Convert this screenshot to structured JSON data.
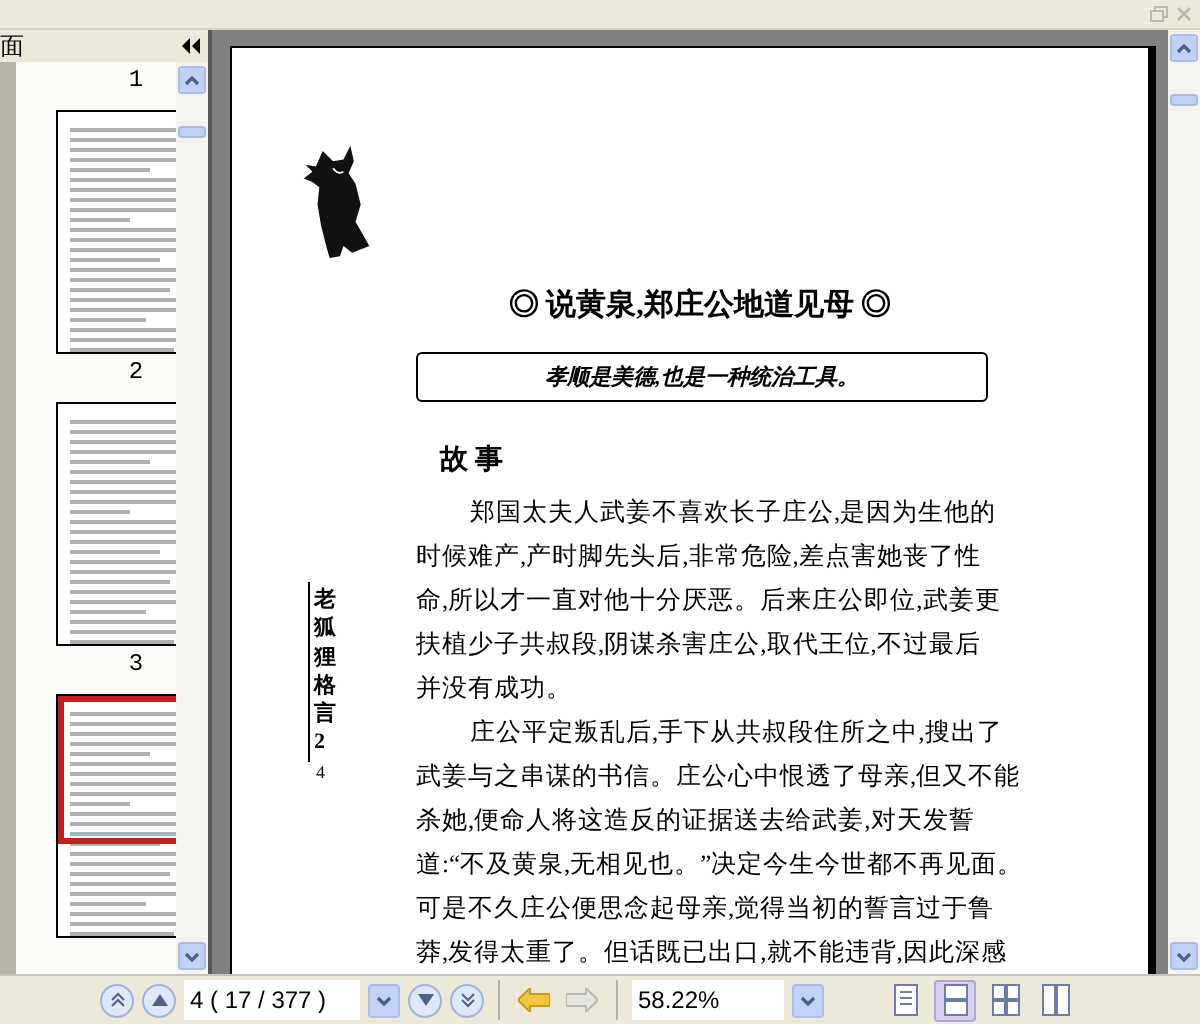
{
  "sidebar": {
    "title": "面",
    "thumbnails": [
      {
        "kind": "caption",
        "label": "1"
      },
      {
        "kind": "page",
        "selected": false
      },
      {
        "kind": "caption",
        "label": "2"
      },
      {
        "kind": "page",
        "selected": false
      },
      {
        "kind": "caption",
        "label": "3"
      },
      {
        "kind": "page",
        "selected": true
      }
    ]
  },
  "document": {
    "title": "◎ 说黄泉,郑庄公地道见母 ◎",
    "quote": "孝顺是美德,也是一种统治工具。",
    "heading": "故 事",
    "side_title": "老狐狸格言2",
    "side_page": "4",
    "paragraphs": [
      [
        "郑国太夫人武姜不喜欢长子庄公,是因为生他的",
        "时候难产,产时脚先头后,非常危险,差点害她丧了性",
        "命,所以才一直对他十分厌恶。后来庄公即位,武姜更",
        "扶植少子共叔段,阴谋杀害庄公,取代王位,不过最后",
        "并没有成功。"
      ],
      [
        "庄公平定叛乱后,手下从共叔段住所之中,搜出了",
        "武姜与之串谋的书信。庄公心中恨透了母亲,但又不能",
        "杀她,便命人将这造反的证据送去给武姜,对天发誓",
        "道:“不及黄泉,无相见也。”决定今生今世都不再见面。",
        "可是不久庄公便思念起母亲,觉得当初的誓言过于鲁",
        "莽,发得太重了。但话既已出口,就不能违背,因此深感"
      ]
    ]
  },
  "toolbar": {
    "page_field": "4 ( 17 / 377 )",
    "back_disabled": false,
    "forward_disabled": true,
    "zoom": "58.22%",
    "view_modes": [
      {
        "kind": "single",
        "selected": false
      },
      {
        "kind": "continuous",
        "selected": true
      },
      {
        "kind": "facing-grid",
        "selected": false
      },
      {
        "kind": "columns",
        "selected": false
      }
    ]
  }
}
